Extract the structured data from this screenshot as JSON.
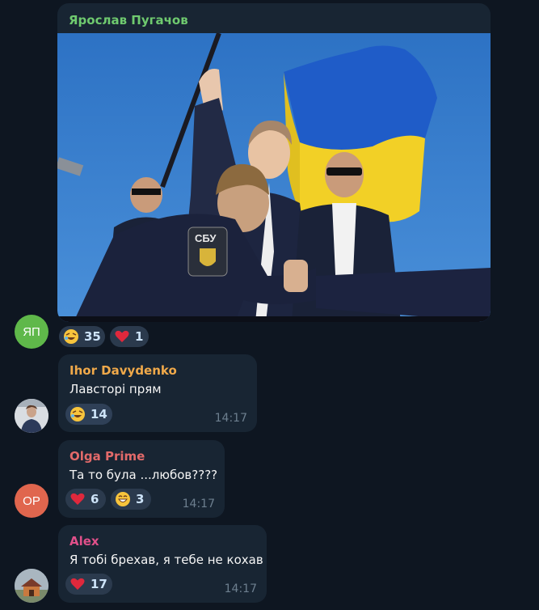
{
  "messages": [
    {
      "sender": "Ярослав Пугачов",
      "sender_color": "#6fca6f",
      "avatar_initials": "ЯП",
      "avatar_color": "#5fb84a",
      "has_photo": true,
      "reactions": [
        {
          "emoji": "rofl-emoji",
          "count": "35"
        },
        {
          "emoji": "heart-emoji",
          "count": "1"
        }
      ]
    },
    {
      "sender": "Ihor Davydenko",
      "sender_color": "#f0a94a",
      "text": "Лавсторі прям",
      "time": "14:17",
      "avatar_type": "photo",
      "reactions": [
        {
          "emoji": "rofl-emoji",
          "count": "14"
        }
      ]
    },
    {
      "sender": "Olga Prime",
      "sender_color": "#e36a6a",
      "text": "Та то була ...любов????",
      "time": "14:17",
      "avatar_initials": "OP",
      "avatar_color": "#e0664e",
      "reactions": [
        {
          "emoji": "heart-emoji",
          "count": "6"
        },
        {
          "emoji": "grin-emoji",
          "count": "3"
        }
      ]
    },
    {
      "sender": "Alex",
      "sender_color": "#e0508a",
      "text": "Я тобі брехав, я тебе не кохав",
      "time": "14:17",
      "avatar_type": "photo",
      "reactions": [
        {
          "emoji": "heart-emoji",
          "count": "17"
        }
      ]
    }
  ]
}
